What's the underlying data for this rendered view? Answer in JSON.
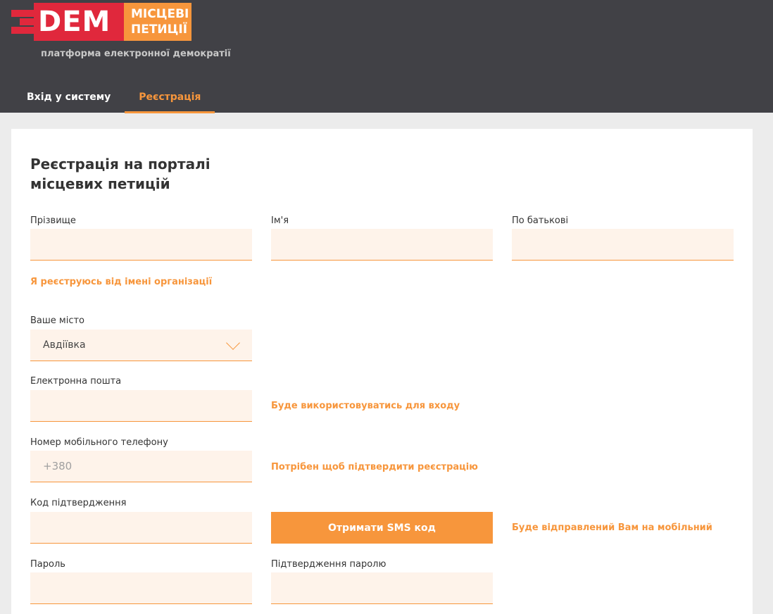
{
  "logo": {
    "dem": "DEM",
    "local_line1": "МІСЦЕВІ",
    "local_line2": "ПЕТИЦІЇ"
  },
  "tagline": "платформа електронної демократії",
  "tabs": [
    {
      "label": "Вхід у систему",
      "active": false
    },
    {
      "label": "Реєстрація",
      "active": true
    }
  ],
  "form": {
    "title_line1": "Реєстрація на порталі",
    "title_line2": "місцевих петицій",
    "surname_label": "Прізвище",
    "name_label": "Ім'я",
    "patronymic_label": "По батькові",
    "org_link": "Я реєструюсь від імені організації",
    "city_label": "Ваше місто",
    "city_value": "Авдіївка",
    "email_label": "Електронна пошта",
    "email_hint": "Буде використовуватись для входу",
    "phone_label": "Номер мобільного телефону",
    "phone_placeholder": "+380",
    "phone_hint": "Потрібен щоб підтвердити реєстрацію",
    "code_label": "Код підтвердження",
    "sms_button": "Отримати SMS код",
    "code_hint": "Буде відправлений Вам на мобільний",
    "password_label": "Пароль",
    "password_confirm_label": "Підтвердження паролю"
  },
  "colors": {
    "header": "#414146",
    "accent": "#f7963c",
    "brand_red": "#e0283c",
    "field_bg": "#fef3ea"
  }
}
